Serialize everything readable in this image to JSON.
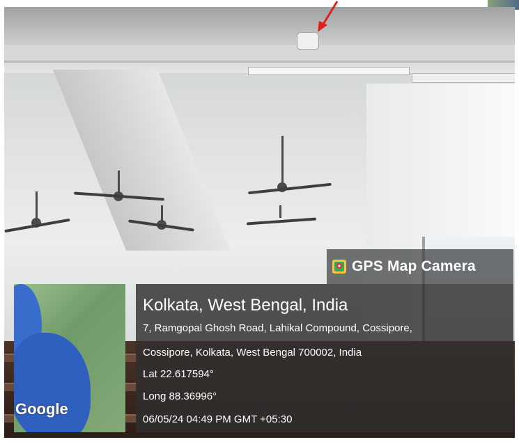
{
  "overlay": {
    "app_name": "GPS Map Camera",
    "location_title": "Kolkata, West Bengal, India",
    "address_line1": "7, Ramgopal Ghosh Road, Lahikal Compound, Cossipore,",
    "address_line2": "Cossipore, Kolkata, West Bengal 700002, India",
    "latitude": "Lat 22.617594°",
    "longitude": "Long 88.36996°",
    "datetime": "06/05/24 04:49 PM GMT +05:30"
  },
  "map": {
    "attribution": "Google"
  },
  "colors": {
    "arrow": "#e0201b",
    "overlay_bg": "#302e2e",
    "map_water": "#2f5fbf"
  },
  "icons": {
    "arrow": "red-arrow-pointer",
    "app": "gps-map-camera-icon"
  }
}
